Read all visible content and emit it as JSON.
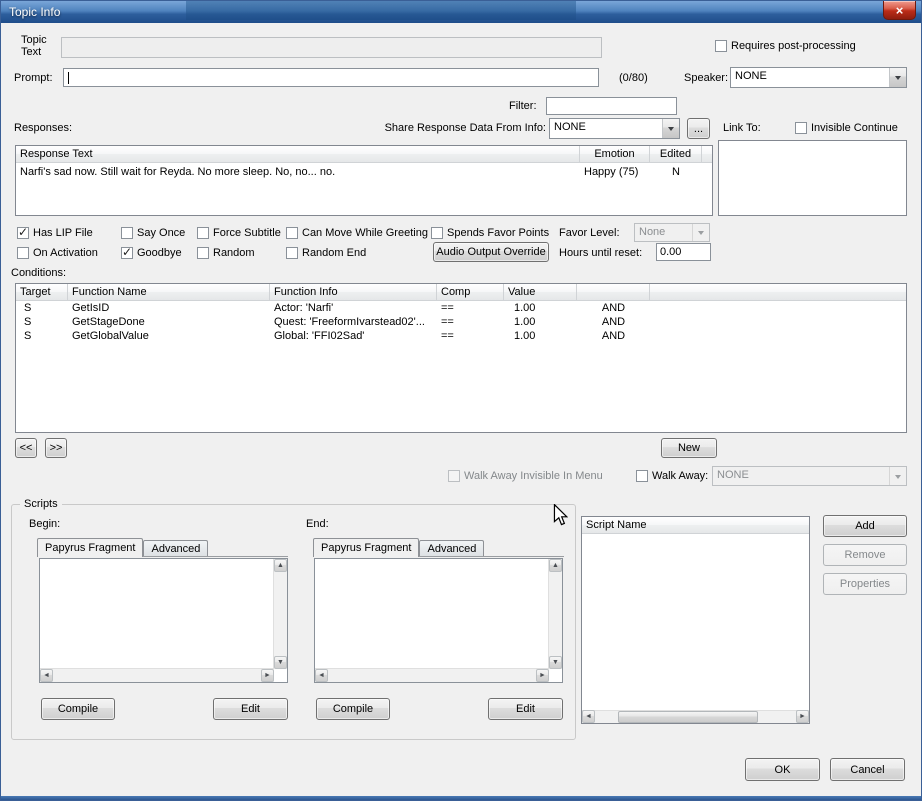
{
  "window": {
    "title": "Topic Info"
  },
  "icons": {
    "close": "×",
    "scroll_up": "▲",
    "scroll_down": "▼",
    "scroll_left": "◄",
    "scroll_right": "►"
  },
  "colors": {
    "titlebar_blue": "#2d5e9d",
    "close_red": "#bb2c18",
    "dialog_bg": "#f0f0f0"
  },
  "header": {
    "topic_text_label": "Topic Text",
    "topic_text_value": "",
    "requires_post_processing": {
      "label": "Requires post-processing",
      "checked": false
    },
    "prompt_label": "Prompt:",
    "prompt_value": "",
    "prompt_counter": "(0/80)",
    "speaker_label": "Speaker:",
    "speaker_value": "NONE",
    "filter_label": "Filter:",
    "filter_value": ""
  },
  "responses": {
    "label": "Responses:",
    "share_label": "Share Response Data From Info:",
    "share_value": "NONE",
    "ellipsis_button": "...",
    "link_to_label": "Link To:",
    "invisible_continue": {
      "label": "Invisible Continue",
      "checked": false
    },
    "columns": [
      "Response Text",
      "Emotion",
      "Edited"
    ],
    "rows": [
      {
        "text": "Narfi's sad now. Still wait for Reyda. No more sleep. No, no... no.",
        "emotion": "Happy (75)",
        "edited": "N"
      }
    ]
  },
  "flags": {
    "row1": [
      {
        "label": "Has LIP File",
        "checked": true
      },
      {
        "label": "Say Once",
        "checked": false
      },
      {
        "label": "Force Subtitle",
        "checked": false
      },
      {
        "label": "Can Move While Greeting",
        "checked": false
      },
      {
        "label": "Spends Favor Points",
        "checked": false
      }
    ],
    "row2": [
      {
        "label": "On Activation",
        "checked": false
      },
      {
        "label": "Goodbye",
        "checked": true
      },
      {
        "label": "Random",
        "checked": false
      },
      {
        "label": "Random End",
        "checked": false
      }
    ],
    "favor_level_label": "Favor Level:",
    "favor_level_value": "None",
    "audio_output_override_label": "Audio Output Override",
    "hours_until_reset_label": "Hours until reset:",
    "hours_until_reset_value": "0.00"
  },
  "conditions": {
    "label": "Conditions:",
    "columns": [
      "Target",
      "Function Name",
      "Function Info",
      "Comp",
      "Value",
      "",
      ""
    ],
    "rows": [
      {
        "target": "S",
        "function_name": "GetIsID",
        "function_info": "Actor: 'Narfi'",
        "comp": "==",
        "value": "1.00",
        "and": "AND"
      },
      {
        "target": "S",
        "function_name": "GetStageDone",
        "function_info": "Quest: 'FreeformIvarstead02'...",
        "comp": "==",
        "value": "1.00",
        "and": "AND"
      },
      {
        "target": "S",
        "function_name": "GetGlobalValue",
        "function_info": "Global: 'FFI02Sad'",
        "comp": "==",
        "value": "1.00",
        "and": "AND"
      }
    ],
    "prev_button": "<<",
    "next_button": ">>",
    "new_button": "New",
    "walk_away_invisible": {
      "label": "Walk Away Invisible In Menu",
      "checked": false
    },
    "walk_away": {
      "label": "Walk Away:",
      "checked": false
    },
    "walk_away_value": "NONE"
  },
  "scripts": {
    "group_label": "Scripts",
    "begin_label": "Begin:",
    "end_label": "End:",
    "tabs": [
      "Papyrus Fragment",
      "Advanced"
    ],
    "compile_button": "Compile",
    "edit_button": "Edit",
    "list_header": "Script Name",
    "add_button": "Add",
    "remove_button": "Remove",
    "properties_button": "Properties"
  },
  "footer": {
    "ok_button": "OK",
    "cancel_button": "Cancel"
  }
}
